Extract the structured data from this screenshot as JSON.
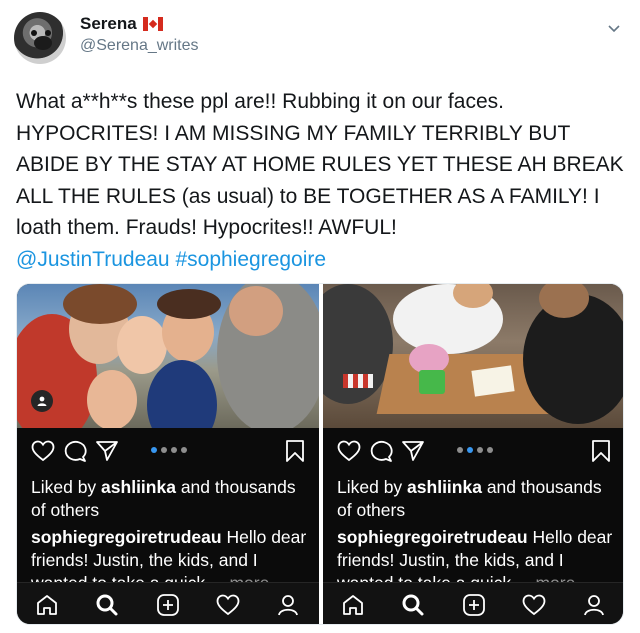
{
  "tweet": {
    "author": {
      "display_name": "Serena",
      "flag": "canada-flag",
      "handle": "@Serena_writes"
    },
    "text": "What a**h**s these ppl are!! Rubbing it on our faces. HYPOCRITES! I AM MISSING MY FAMILY TERRIBLY BUT ABIDE BY THE STAY AT HOME RULES YET THESE AH BREAK ALL THE RULES (as usual) to BE TOGETHER AS A FAMILY!  I loath them. Frauds! Hypocrites!! AWFUL!",
    "mention": "@JustinTrudeau",
    "hashtag": "#sophiegregoire",
    "link_color": "#1b95e0"
  },
  "instagram_posts": [
    {
      "likes_prefix": "Liked by ",
      "liked_by": "ashliinka",
      "likes_suffix": " and thousands of others",
      "caption_user": "sophiegregoiretrudeau",
      "caption_text": " Hello dear friends! Justin, the kids, and I wanted to take a quick",
      "more_label": "... more"
    },
    {
      "likes_prefix": "Liked by ",
      "liked_by": "ashliinka",
      "likes_suffix": " and thousands of others",
      "caption_user": "sophiegregoiretrudeau",
      "caption_text": " Hello dear friends! Justin, the kids, and I wanted to take a quick",
      "more_label": "... more"
    }
  ],
  "icons": {
    "action_bar": [
      "heart-icon",
      "comment-icon",
      "share-icon",
      "bookmark-icon"
    ],
    "nav_bar": [
      "home-icon",
      "search-icon",
      "new-post-icon",
      "activity-icon",
      "profile-icon"
    ]
  }
}
